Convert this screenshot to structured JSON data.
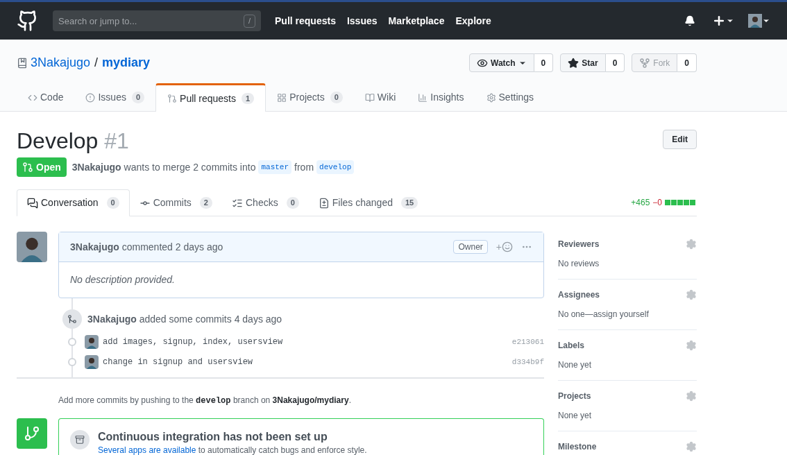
{
  "header": {
    "search_placeholder": "Search or jump to...",
    "search_key": "/",
    "nav": [
      "Pull requests",
      "Issues",
      "Marketplace",
      "Explore"
    ]
  },
  "repo": {
    "owner": "3Nakajugo",
    "separator": "/",
    "name": "mydiary",
    "actions": [
      {
        "kind": "watch",
        "label": "Watch",
        "count": "0",
        "disabled": false
      },
      {
        "kind": "star",
        "label": "Star",
        "count": "0",
        "disabled": false
      },
      {
        "kind": "fork",
        "label": "Fork",
        "count": "0",
        "disabled": true
      }
    ]
  },
  "tabs": [
    {
      "kind": "code",
      "label": "Code",
      "selected": false
    },
    {
      "kind": "issues",
      "label": "Issues",
      "count": "0",
      "selected": false
    },
    {
      "kind": "pulls",
      "label": "Pull requests",
      "count": "1",
      "selected": true
    },
    {
      "kind": "projects",
      "label": "Projects",
      "count": "0",
      "selected": false
    },
    {
      "kind": "wiki",
      "label": "Wiki",
      "selected": false
    },
    {
      "kind": "insights",
      "label": "Insights",
      "selected": false
    },
    {
      "kind": "settings",
      "label": "Settings",
      "selected": false
    }
  ],
  "pr": {
    "title": "Develop",
    "number": "#1",
    "state": "Open",
    "author": "3Nakajugo",
    "merge_text": "wants to merge 2 commits into",
    "base": "master",
    "from_text": "from",
    "head": "develop",
    "edit": "Edit"
  },
  "pr_tabs": [
    {
      "kind": "conversation",
      "label": "Conversation",
      "count": "0",
      "selected": true
    },
    {
      "kind": "commits",
      "label": "Commits",
      "count": "2",
      "selected": false
    },
    {
      "kind": "checks",
      "label": "Checks",
      "count": "0",
      "selected": false
    },
    {
      "kind": "files",
      "label": "Files changed",
      "count": "15",
      "selected": false
    }
  ],
  "diffstat": {
    "additions": "+465",
    "deletions": "−0"
  },
  "comment": {
    "author": "3Nakajugo",
    "action": "commented 2 days ago",
    "badge": "Owner",
    "reaction": "+",
    "body": "No description provided."
  },
  "commits_event": {
    "author": "3Nakajugo",
    "text": "added some commits 4 days ago",
    "commits": [
      {
        "message": "add images, signup, index, usersview",
        "sha": "e213061"
      },
      {
        "message": "change in signup and usersview",
        "sha": "d334b9f"
      }
    ]
  },
  "hint": {
    "before": "Add more commits by pushing to the",
    "branch": "develop",
    "middle": "branch on",
    "repo": "3Nakajugo/mydiary",
    "after": "."
  },
  "ci": {
    "title": "Continuous integration has not been set up",
    "link": "Several apps are available",
    "rest": "to automatically catch bugs and enforce style."
  },
  "sidebar": [
    {
      "title": "Reviewers",
      "value": "No reviews"
    },
    {
      "title": "Assignees",
      "value": "No one—assign yourself"
    },
    {
      "title": "Labels",
      "value": "None yet"
    },
    {
      "title": "Projects",
      "value": "None yet"
    },
    {
      "title": "Milestone"
    }
  ]
}
